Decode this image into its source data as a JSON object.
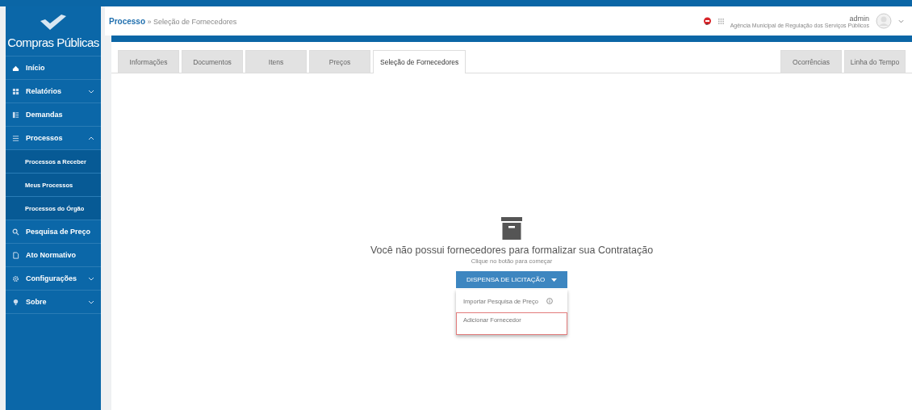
{
  "sidebar": {
    "logo_text": "Compras Públicas",
    "items": [
      {
        "label": "Início"
      },
      {
        "label": "Relatórios",
        "expanded": false
      },
      {
        "label": "Demandas"
      },
      {
        "label": "Processos",
        "expanded": true,
        "children": [
          {
            "label": "Processos a Receber"
          },
          {
            "label": "Meus Processos"
          },
          {
            "label": "Processos do Órgão"
          }
        ]
      },
      {
        "label": "Pesquisa de Preço"
      },
      {
        "label": "Ato Normativo"
      },
      {
        "label": "Configurações",
        "expanded": false
      },
      {
        "label": "Sobre",
        "expanded": false
      }
    ]
  },
  "header": {
    "breadcrumb": {
      "root": "Processo",
      "separator": "»",
      "current": "Seleção de Fornecedores"
    },
    "user": {
      "name": "admin",
      "organization": "Agência Municipal de Regulação dos Serviços Públicos"
    }
  },
  "tabs": [
    {
      "label": "Informações",
      "selected": false
    },
    {
      "label": "Documentos",
      "selected": false
    },
    {
      "label": "Itens",
      "selected": false
    },
    {
      "label": "Preços",
      "selected": false
    },
    {
      "label": "Seleção de Fornecedores",
      "selected": true
    }
  ],
  "right_tabs": [
    {
      "label": "Ocorrências",
      "selected": false
    },
    {
      "label": "Linha do Tempo",
      "selected": false
    }
  ],
  "empty_state": {
    "title": "Você não possui fornecedores para formalizar sua Contratação",
    "subtitle": "Clique no botão para começar"
  },
  "dropdown": {
    "button": "DISPENSA DE LICITAÇÃO",
    "items": [
      {
        "label": "Importar Pesquisa de Preço",
        "info": true,
        "selected": false
      },
      {
        "label": "Adicionar Fornecedor",
        "info": false,
        "selected": true
      }
    ]
  }
}
